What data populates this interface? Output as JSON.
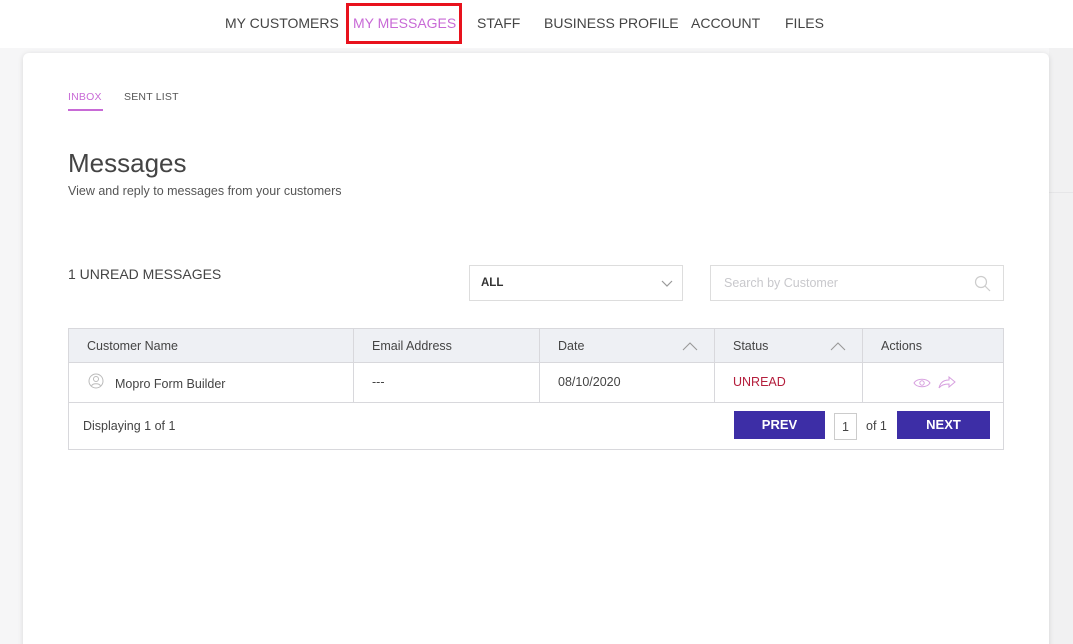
{
  "nav": {
    "items": [
      {
        "label": "MY CUSTOMERS"
      },
      {
        "label": "MY MESSAGES"
      },
      {
        "label": "STAFF"
      },
      {
        "label": "BUSINESS PROFILE"
      },
      {
        "label": "ACCOUNT"
      },
      {
        "label": "FILES"
      }
    ],
    "active": "MY MESSAGES"
  },
  "subtabs": [
    {
      "label": "INBOX"
    },
    {
      "label": "SENT LIST"
    }
  ],
  "page": {
    "title": "Messages",
    "subtitle": "View and reply to messages from your customers"
  },
  "toolbar": {
    "unread_count": "1 UNREAD MESSAGES",
    "filter_value": "ALL",
    "search_placeholder": "Search by Customer"
  },
  "table": {
    "columns": [
      "Customer Name",
      "Email Address",
      "Date",
      "Status",
      "Actions"
    ],
    "rows": [
      {
        "customer": "Mopro Form Builder",
        "email": "---",
        "date": "08/10/2020",
        "status": "UNREAD"
      }
    ],
    "footer": {
      "displaying": "Displaying 1 of 1",
      "prev_label": "PREV",
      "page": "1",
      "of_text": "of 1",
      "next_label": "NEXT"
    }
  },
  "colors": {
    "accent": "#c86ad6",
    "button": "#3d2ea6",
    "unread": "#b41e3c",
    "highlight": "#e8121d"
  },
  "icons": [
    "chevron-down-icon",
    "search-icon",
    "sort-up-icon",
    "person-icon",
    "eye-icon",
    "reply-icon"
  ]
}
